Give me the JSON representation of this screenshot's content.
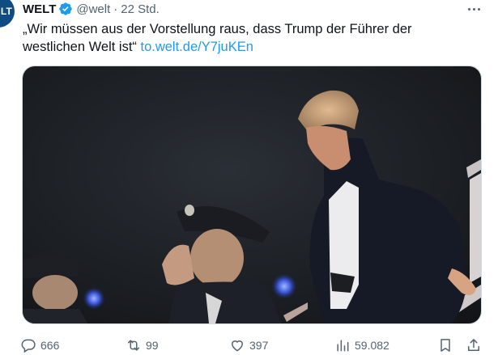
{
  "tweet": {
    "author_name": "WELT",
    "handle": "@welt",
    "separator": "·",
    "time": "22 Std.",
    "avatar_text": "LT",
    "text": "„Wir müssen aus der Vorstellung raus, dass Trump der Führer der westlichen Welt ist“ ",
    "link": "to.welt.de/Y7juKEn"
  },
  "media": {
    "icon": "photo"
  },
  "actions": {
    "replies": "666",
    "reposts": "99",
    "likes": "397",
    "views": "59.082"
  },
  "colors": {
    "link": "#1d9bf0",
    "verified": "#1d9bf0",
    "muted": "#536471",
    "avatar_bg": "#0f4c81"
  }
}
